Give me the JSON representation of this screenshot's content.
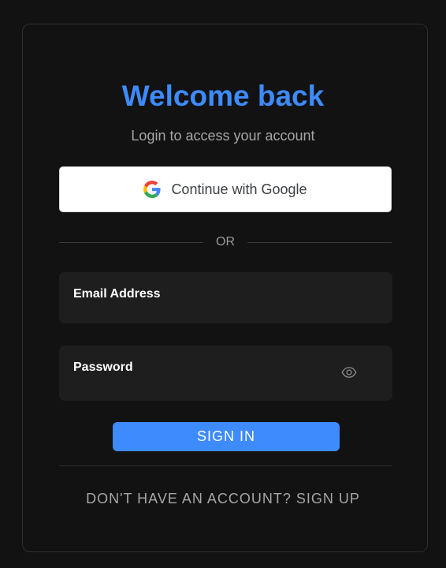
{
  "header": {
    "title": "Welcome back",
    "subtitle": "Login to access your account"
  },
  "google_button": {
    "label": "Continue with Google",
    "icon": "google-g-icon"
  },
  "divider": {
    "text": "OR"
  },
  "form": {
    "email": {
      "label": "Email Address",
      "value": ""
    },
    "password": {
      "label": "Password",
      "value": "",
      "toggle_icon": "eye-icon"
    },
    "submit_label": "SIGN IN"
  },
  "footer": {
    "signup_text": "DON'T HAVE AN ACCOUNT? SIGN UP"
  },
  "colors": {
    "accent": "#3d8bfd",
    "background": "#121212",
    "field_background": "#1e1e1e",
    "muted_text": "#a6a6a6"
  }
}
